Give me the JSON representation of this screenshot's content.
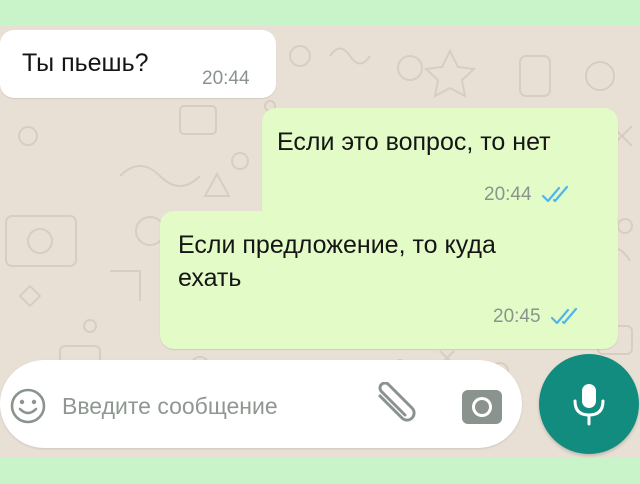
{
  "messages": [
    {
      "direction": "incoming",
      "text": "Ты пьешь?",
      "time": "20:44"
    },
    {
      "direction": "outgoing",
      "text": "Если это вопрос, то нет",
      "time": "20:44",
      "status": "read"
    },
    {
      "direction": "outgoing",
      "lines": [
        "Если предложение, то куда",
        "ехать"
      ],
      "time": "20:45",
      "status": "read"
    }
  ],
  "composer": {
    "placeholder": "Введите сообщение",
    "value": ""
  },
  "icons": {
    "emoji": "smiley-face-icon",
    "attach": "paperclip-icon",
    "camera": "camera-icon",
    "mic": "microphone-icon",
    "read_receipt": "double-check-icon"
  },
  "colors": {
    "incoming_bubble": "#ffffff",
    "outgoing_bubble": "#e2fbc7",
    "mic_button": "#128c7e",
    "read_ticks": "#4fb6ec",
    "wallpaper": "#e9e0d5"
  }
}
